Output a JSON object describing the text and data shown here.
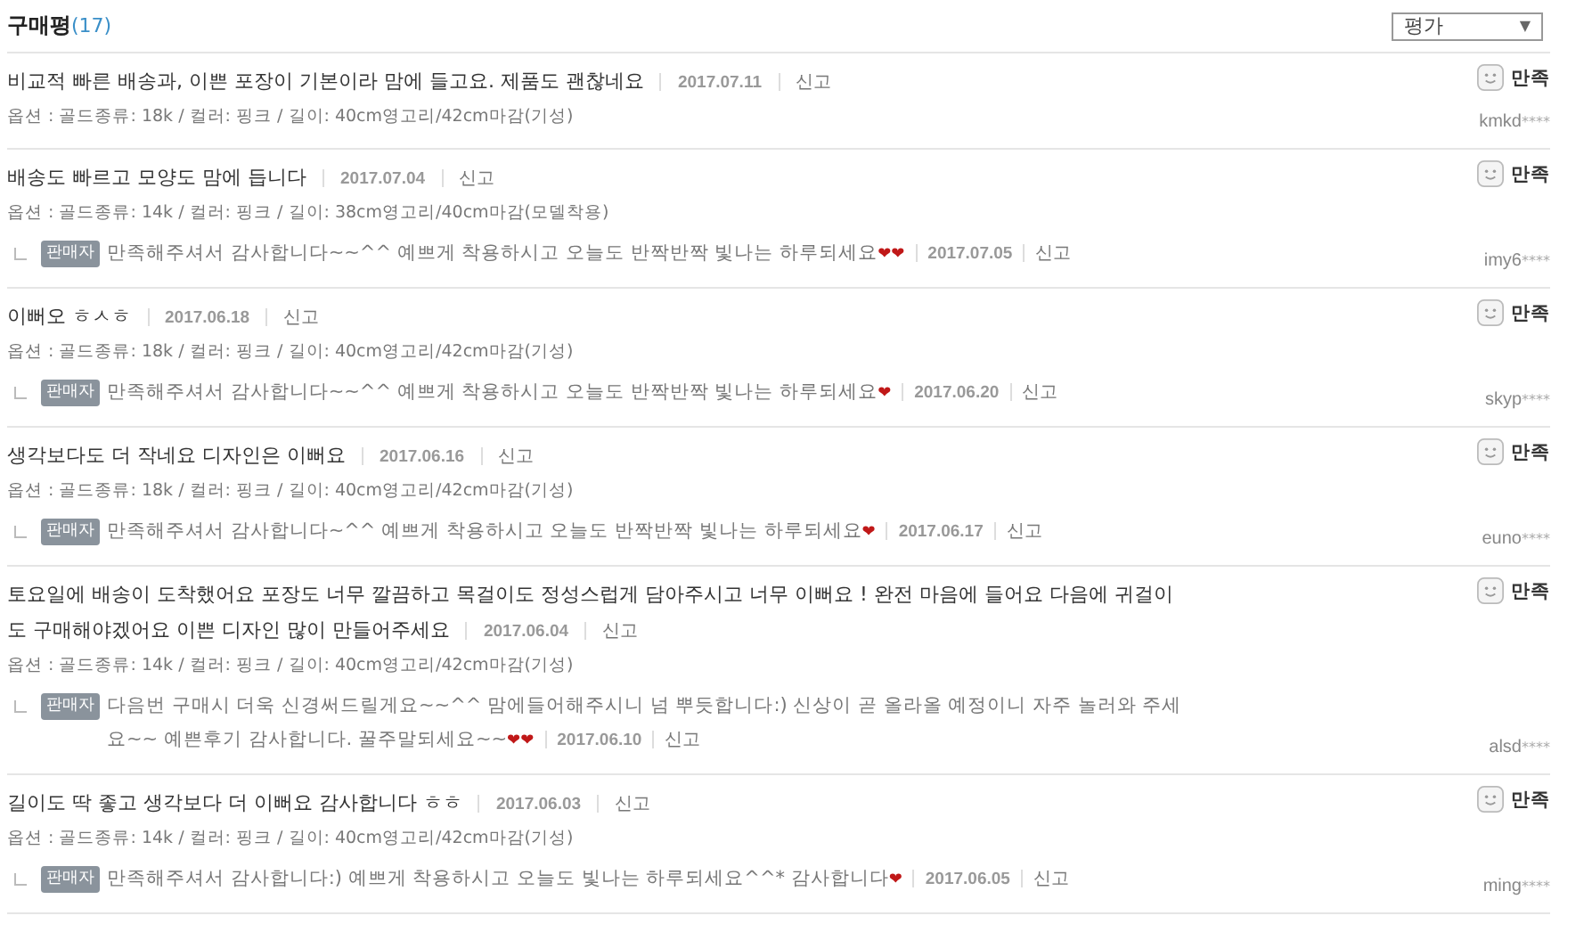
{
  "header": {
    "title": "구매평",
    "count": "(17)",
    "filter": {
      "value": "평가",
      "arrow": "▼"
    }
  },
  "reviews": [
    {
      "text": "비교적 빠른 배송과, 이쁜 포장이 기본이라 맘에 들고요. 제품도 괜찮네요",
      "date": "2017.07.11",
      "report": "신고",
      "option": "옵션 : 골드종류: 18k / 컬러: 핑크 / 길이: 40cm영고리/42cm마감(기성)",
      "rating": "만족",
      "user": "kmkd",
      "mask": "****"
    },
    {
      "text": "배송도 빠르고 모양도 맘에 듭니다",
      "date": "2017.07.04",
      "report": "신고",
      "option": "옵션 : 골드종류: 14k / 컬러: 핑크 / 길이: 38cm영고리/40cm마감(모델착용)",
      "rating": "만족",
      "user": "imy6",
      "mask": "****",
      "reply": {
        "badge": "판매자",
        "text": "만족해주셔서 감사합니다~~^^ 예쁘게 착용하시고 오늘도 반짝반짝 빛나는 하루되세요",
        "hearts": "❤❤",
        "date": "2017.07.05",
        "report": "신고"
      }
    },
    {
      "text": "이뻐오 ㅎㅅㅎ",
      "date": "2017.06.18",
      "report": "신고",
      "option": "옵션 : 골드종류: 18k / 컬러: 핑크 / 길이: 40cm영고리/42cm마감(기성)",
      "rating": "만족",
      "user": "skyp",
      "mask": "****",
      "reply": {
        "badge": "판매자",
        "text": "만족해주셔서 감사합니다~~^^ 예쁘게 착용하시고 오늘도 반짝반짝 빛나는 하루되세요",
        "hearts": "❤",
        "date": "2017.06.20",
        "report": "신고"
      }
    },
    {
      "text": "생각보다도 더 작네요 디자인은 이뻐요",
      "date": "2017.06.16",
      "report": "신고",
      "option": "옵션 : 골드종류: 18k / 컬러: 핑크 / 길이: 40cm영고리/42cm마감(기성)",
      "rating": "만족",
      "user": "euno",
      "mask": "****",
      "reply": {
        "badge": "판매자",
        "text": "만족해주셔서 감사합니다~^^ 예쁘게 착용하시고 오늘도 반짝반짝 빛나는 하루되세요",
        "hearts": "❤",
        "date": "2017.06.17",
        "report": "신고"
      }
    },
    {
      "text": [
        "토요일에 배송이 도착했어요 포장도 너무 깔끔하고 목걸이도 정성스럽게 담아주시고 너무 이뻐요 ! 완전 마음에 들어요 다음에 귀걸이",
        "도 구매해야겠어요 이쁜 디자인 많이 만들어주세요"
      ],
      "date": "2017.06.04",
      "report": "신고",
      "option": "옵션 : 골드종류: 14k / 컬러: 핑크 / 길이: 40cm영고리/42cm마감(기성)",
      "rating": "만족",
      "user": "alsd",
      "mask": "****",
      "reply": {
        "badge": "판매자",
        "text": [
          "다음번 구매시 더욱 신경써드릴게요~~^^ 맘에들어해주시니 넘 뿌듯합니다:) 신상이 곧 올라올 예정이니 자주 놀러와 주세",
          "요~~ 예쁜후기 감사합니다. 꿀주말되세요~~"
        ],
        "hearts": "❤❤",
        "date": "2017.06.10",
        "report": "신고"
      }
    },
    {
      "text": "길이도 딱 좋고 생각보다 더 이뻐요 감사합니다 ㅎㅎ",
      "date": "2017.06.03",
      "report": "신고",
      "option": "옵션 : 골드종류: 14k / 컬러: 핑크 / 길이: 40cm영고리/42cm마감(기성)",
      "rating": "만족",
      "user": "ming",
      "mask": "****",
      "reply": {
        "badge": "판매자",
        "text": "만족해주셔서 감사합니다:) 예쁘게 착용하시고 오늘도 빛나는 하루되세요^^* 감사합니다",
        "hearts": "❤",
        "date": "2017.06.05",
        "report": "신고"
      }
    }
  ]
}
